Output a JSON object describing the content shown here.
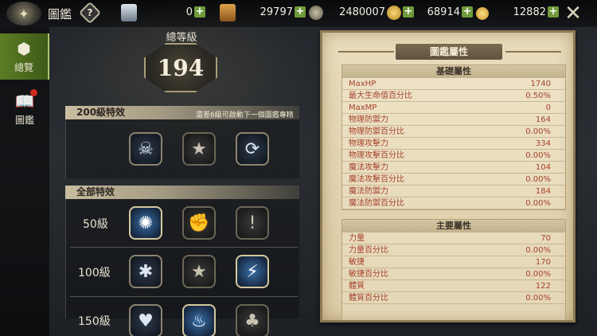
{
  "header": {
    "title": "圖鑑",
    "help_label": "?",
    "currencies": [
      {
        "icon": "card-icon",
        "value": "0"
      },
      {
        "icon": "scroll-icon",
        "value": "29797"
      },
      {
        "icon": "gear-coin-icon",
        "value": "2480007"
      },
      {
        "icon": "gold-coin-icon",
        "value": "68914"
      },
      {
        "icon": "yellow-coin-icon",
        "value": "12882"
      }
    ],
    "plus_label": "+",
    "close_label": "✕"
  },
  "sidebar": {
    "items": [
      {
        "label": "總覽",
        "icon": "overview-icon",
        "active": true
      },
      {
        "label": "圖鑑",
        "icon": "book-icon",
        "active": false
      }
    ]
  },
  "level": {
    "title": "總等級",
    "value": "194"
  },
  "section200": {
    "title": "200級特效",
    "note": "還差6級可啟動下一個圖鑑專精",
    "icons": [
      "skull-icon",
      "star-icon",
      "sword-swirl-icon"
    ]
  },
  "all_effects": {
    "title": "全部特效",
    "rows": [
      {
        "label": "50級",
        "icons": [
          "figure-icon",
          "fist-icon",
          "sword-icon"
        ]
      },
      {
        "label": "100級",
        "icons": [
          "snowflake-icon",
          "star-icon",
          "lightning-sword-icon"
        ]
      },
      {
        "label": "150級",
        "icons": [
          "heart-icon",
          "flame-icon",
          "tree-icon"
        ]
      }
    ]
  },
  "stats": {
    "title": "圖鑑屬性",
    "basic": {
      "title": "基礎屬性",
      "rows": [
        {
          "name": "MaxHP",
          "value": "1740"
        },
        {
          "name": "最大生命值百分比",
          "value": "0.50%"
        },
        {
          "name": "MaxMP",
          "value": "0"
        },
        {
          "name": "物理防禦力",
          "value": "164"
        },
        {
          "name": "物理防禦百分比",
          "value": "0.00%"
        },
        {
          "name": "物理攻擊力",
          "value": "334"
        },
        {
          "name": "物理攻擊百分比",
          "value": "0.00%"
        },
        {
          "name": "魔法攻擊力",
          "value": "104"
        },
        {
          "name": "魔法攻擊百分比",
          "value": "0.00%"
        },
        {
          "name": "魔法防禦力",
          "value": "184"
        },
        {
          "name": "魔法防禦百分比",
          "value": "0.00%"
        }
      ]
    },
    "main": {
      "title": "主要屬性",
      "rows": [
        {
          "name": "力量",
          "value": "70"
        },
        {
          "name": "力量百分比",
          "value": "0.00%"
        },
        {
          "name": "敏捷",
          "value": "170"
        },
        {
          "name": "敏捷百分比",
          "value": "0.00%"
        },
        {
          "name": "體質",
          "value": "122"
        },
        {
          "name": "體質百分比",
          "value": "0.00%"
        }
      ]
    }
  }
}
